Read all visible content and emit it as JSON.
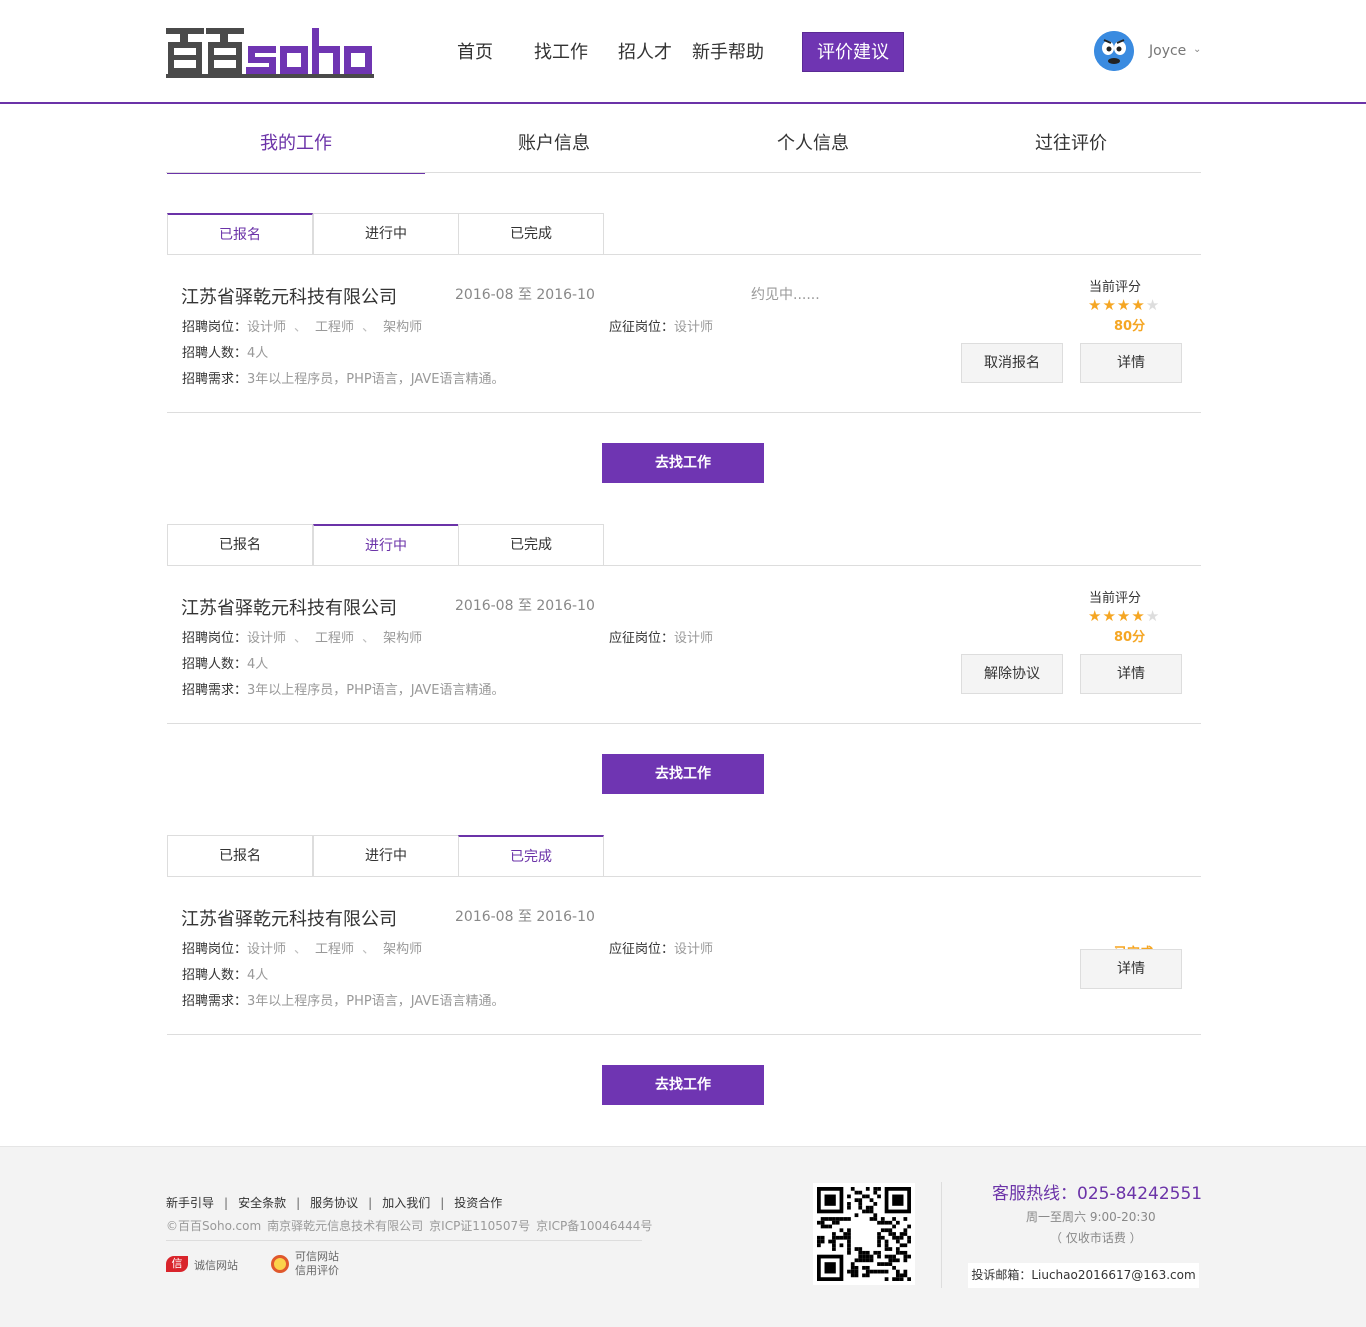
{
  "header": {
    "logo_text": "百百soho",
    "nav": [
      "首页",
      "找工作",
      "招人才",
      "新手帮助"
    ],
    "nav_highlight": "评价建议",
    "username": "Joyce",
    "chevron": "⌄"
  },
  "tabs": [
    "我的工作",
    "账户信息",
    "个人信息",
    "过往评价"
  ],
  "labels": {
    "position": "招聘岗位：",
    "headcount": "招聘人数：",
    "requirement": "招聘需求：",
    "applied": "应征岗位：",
    "rating": "当前评分",
    "details_button": "详情",
    "go_button": "去找工作"
  },
  "subtabs": [
    "已报名",
    "进行中",
    "已完成"
  ],
  "sections": [
    {
      "active_subtab": 0,
      "company": "江苏省驿乾元科技有限公司",
      "date_range": "2016-08 至 2016-10",
      "status_note": "约见中......",
      "positions": [
        "设计师",
        "工程师",
        "架构师"
      ],
      "position_sep": "、",
      "headcount": "4人",
      "requirement": "3年以上程序员，PHP语言，JAVE语言精通。",
      "applied": "设计师",
      "rating": 4,
      "rating_max": 5,
      "score": "80分",
      "action_button": "取消报名"
    },
    {
      "active_subtab": 1,
      "company": "江苏省驿乾元科技有限公司",
      "date_range": "2016-08 至 2016-10",
      "positions": [
        "设计师",
        "工程师",
        "架构师"
      ],
      "position_sep": "、",
      "headcount": "4人",
      "requirement": "3年以上程序员，PHP语言，JAVE语言精通。",
      "applied": "设计师",
      "rating": 4,
      "rating_max": 5,
      "score": "80分",
      "action_button": "解除协议"
    },
    {
      "active_subtab": 2,
      "company": "江苏省驿乾元科技有限公司",
      "date_range": "2016-08 至 2016-10",
      "positions": [
        "设计师",
        "工程师",
        "架构师"
      ],
      "position_sep": "、",
      "headcount": "4人",
      "requirement": "3年以上程序员，PHP语言，JAVE语言精通。",
      "applied": "设计师",
      "done_badge": "已完成"
    }
  ],
  "footer": {
    "links": [
      "新手引导",
      "安全条款",
      "服务协议",
      "加入我们",
      "投资合作"
    ],
    "link_sep": "|",
    "copyright": [
      "©百百Soho.com",
      "南京驿乾元信息技术有限公司",
      "京ICP证110507号",
      "京ICP备10046444号"
    ],
    "badge1_icon": "信",
    "badge1_text": "诚信网站",
    "badge2_line1": "可信网站",
    "badge2_line2": "信用评价",
    "hotline": "客服热线：025-84242551",
    "hours": "周一至周六 9:00-20:30",
    "hours_note": "（ 仅收市话费 ）",
    "email": "投诉邮箱：Liuchao2016617@163.com"
  },
  "colors": {
    "brand": "#6b33a8",
    "button": "#6f35b2",
    "star": "#f5a623"
  }
}
